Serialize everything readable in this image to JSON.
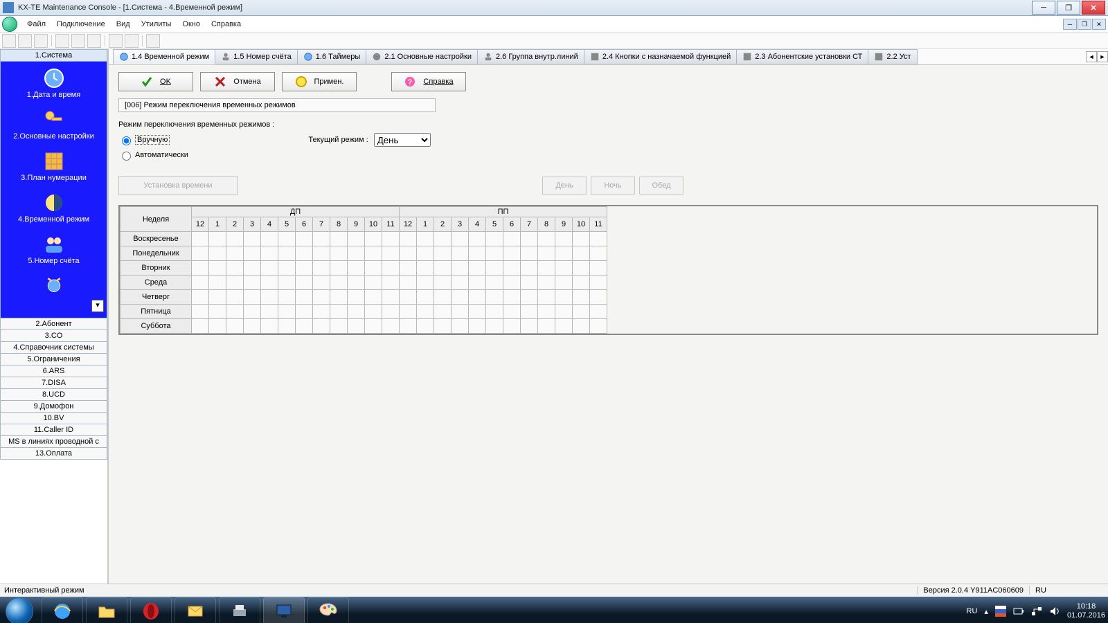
{
  "window": {
    "title": "KX-TE Maintenance Console - [1.Система - 4.Временной режим]"
  },
  "menubar": [
    "Файл",
    "Подключение",
    "Вид",
    "Утилиты",
    "Окно",
    "Справка"
  ],
  "sidebar": {
    "header": "1.Система",
    "items": [
      {
        "label": "1.Дата и время"
      },
      {
        "label": "2.Основные настройки"
      },
      {
        "label": "3.План нумерации"
      },
      {
        "label": "4.Временной режим"
      },
      {
        "label": "5.Номер счёта"
      }
    ],
    "extra": [
      "2.Абонент",
      "3.CO",
      "4.Справочник системы",
      "5.Ограничения",
      "6.ARS",
      "7.DISA",
      "8.UCD",
      "9.Домофон",
      "10.BV",
      "11.Caller ID",
      "MS в линиях проводной с",
      "13.Оплата"
    ]
  },
  "tabs": [
    "1.4 Временной режим",
    "1.5 Номер счёта",
    "1.6 Таймеры",
    "2.1 Основные настройки",
    "2.6 Группа внутр.линий",
    "2.4 Кнопки с назначаемой функцией",
    "2.3 Абонентские установки СТ",
    "2.2 Уст"
  ],
  "actions": {
    "ok": "OK",
    "cancel": "Отмена",
    "apply": "Примен.",
    "help": "Справка"
  },
  "form": {
    "title": "[006] Режим переключения временных режимов",
    "mode_label": "Режим переключения временных режимов :",
    "manual": "Вручную",
    "auto": "Автоматически",
    "current_label": "Текущий режим :",
    "current_value": "День",
    "setup_time": "Установка времени",
    "mode_buttons": [
      "День",
      "Ночь",
      "Обед"
    ]
  },
  "schedule": {
    "week_header": "Неделя",
    "halves": [
      "ДП",
      "ПП"
    ],
    "hours": [
      "12",
      "1",
      "2",
      "3",
      "4",
      "5",
      "6",
      "7",
      "8",
      "9",
      "10",
      "11",
      "12",
      "1",
      "2",
      "3",
      "4",
      "5",
      "6",
      "7",
      "8",
      "9",
      "10",
      "11"
    ],
    "days": [
      "Воскресенье",
      "Понедельник",
      "Вторник",
      "Среда",
      "Четверг",
      "Пятница",
      "Суббота"
    ]
  },
  "statusbar": {
    "left": "Интерактивный режим",
    "version": "Версия 2.0.4 Y911AC060609",
    "lang": "RU"
  },
  "taskbar": {
    "lang": "RU",
    "time": "10:18",
    "date": "01.07.2016"
  }
}
